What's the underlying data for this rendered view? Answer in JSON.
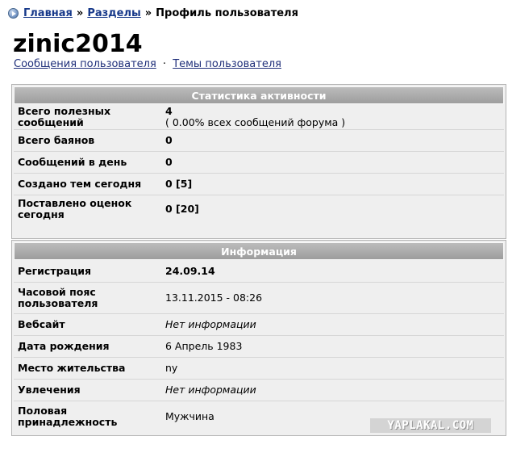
{
  "breadcrumb": {
    "home": "Главная",
    "sep1": "»",
    "sections": "Разделы",
    "sep2": "»",
    "current": "Профиль пользователя"
  },
  "profile": {
    "username": "zinic2014",
    "link_posts": "Сообщения пользователя",
    "link_dot": "·",
    "link_topics": "Темы пользователя"
  },
  "stats": {
    "title": "Статистика активности",
    "rows": [
      {
        "label": "Всего полезных сообщений",
        "value": "4",
        "note": "( 0.00% всех сообщений форума )"
      },
      {
        "label": "Всего баянов",
        "value": "0"
      },
      {
        "label": "Сообщений в день",
        "value": "0"
      },
      {
        "label": "Создано тем сегодня",
        "value": "0 [5]"
      },
      {
        "label": "Поставлено оценок сегодня",
        "value": "0 [20]"
      }
    ]
  },
  "info": {
    "title": "Информация",
    "rows": [
      {
        "label": "Регистрация",
        "value": "24.09.14"
      },
      {
        "label": "Часовой пояс пользователя",
        "value": "13.11.2015 - 08:26"
      },
      {
        "label": "Вебсайт",
        "value": "Нет информации"
      },
      {
        "label": "Дата рождения",
        "value": "6 Апрель 1983"
      },
      {
        "label": "Место жительства",
        "value": "ny"
      },
      {
        "label": "Увлечения",
        "value": "Нет информации"
      },
      {
        "label": "Половая принадлежность",
        "value": "Мужчина"
      }
    ]
  },
  "watermark": "YAPLAKAL.COM",
  "icons": {
    "nav": "arrow-circle-icon"
  }
}
